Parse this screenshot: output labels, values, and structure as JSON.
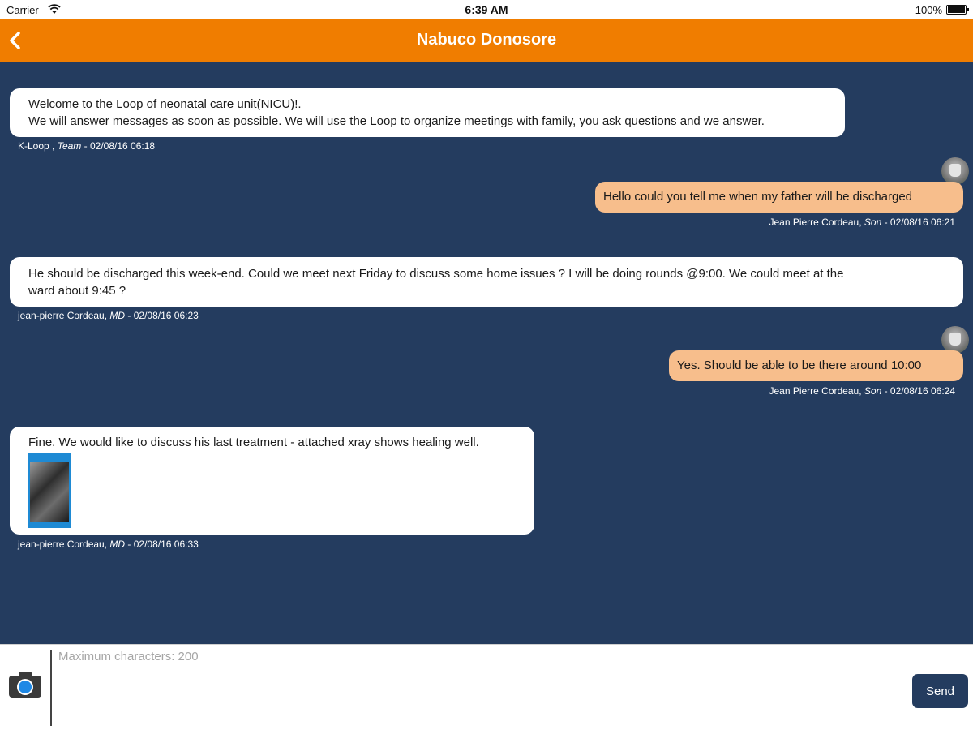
{
  "status_bar": {
    "carrier": "Carrier",
    "time": "6:39 AM",
    "battery": "100%"
  },
  "nav": {
    "title": "Nabuco Donosore",
    "back_icon": "chevron-left-icon"
  },
  "colors": {
    "nav_bg": "#f07d00",
    "chat_bg": "#243c5f",
    "incoming_bubble": "#ffffff",
    "outgoing_bubble": "#f7be8c",
    "send_button": "#243c5f"
  },
  "messages": [
    {
      "direction": "incoming",
      "lines": [
        "Welcome to the Loop of neonatal care unit(NICU)!.",
        "We will answer messages as soon as possible. We will use the Loop to organize meetings with family, you ask questions and we answer."
      ],
      "sender": "K-Loop ,",
      "role": "Team",
      "timestamp": "- 02/08/16 06:18"
    },
    {
      "direction": "outgoing",
      "lines": [
        "Hello could you tell me when my father will be discharged"
      ],
      "sender": "Jean Pierre Cordeau,",
      "role": "Son",
      "timestamp": "- 02/08/16 06:21"
    },
    {
      "direction": "incoming",
      "lines": [
        "He should be discharged this week-end. Could we meet next Friday to discuss some home issues ? I will be doing rounds @9:00. We could meet at the",
        "ward about 9:45 ?"
      ],
      "sender": "jean-pierre Cordeau,",
      "role": "MD",
      "timestamp": "- 02/08/16 06:23"
    },
    {
      "direction": "outgoing",
      "lines": [
        "Yes. Should be able to be there around 10:00"
      ],
      "sender": "Jean Pierre Cordeau,",
      "role": "Son",
      "timestamp": "- 02/08/16 06:24"
    },
    {
      "direction": "incoming",
      "lines": [
        "Fine. We would like to discuss his last treatment - attached xray shows healing well."
      ],
      "attachment": "xray-thumbnail",
      "sender": "jean-pierre Cordeau,",
      "role": "MD",
      "timestamp": "- 02/08/16 06:33"
    }
  ],
  "composer": {
    "placeholder": "Maximum characters: 200",
    "value": "",
    "send_label": "Send",
    "camera_icon": "camera-icon"
  }
}
